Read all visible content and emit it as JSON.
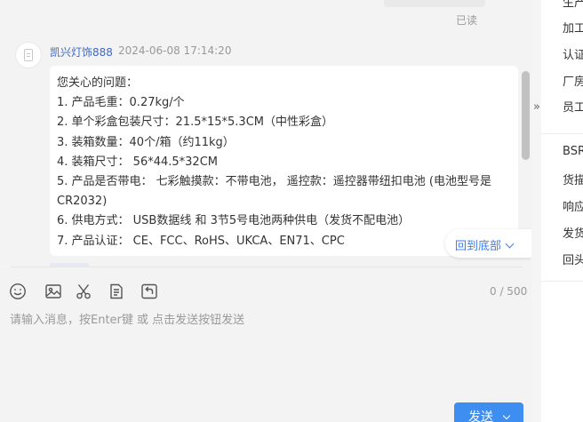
{
  "chat": {
    "read_status": "已读",
    "message": {
      "sender": "凯兴灯饰888",
      "timestamp": "2024-06-08 17:14:20",
      "lines": [
        " 您关心的问题：",
        "1. 产品毛重：0.27kg/个",
        "2. 单个彩盒包装尺寸：21.5*15*5.3CM（中性彩盒）",
        "3. 装箱数量：40个/箱（约11kg）",
        "4. 装箱尺寸： 56*44.5*32CM",
        "5. 产品是否带电： 七彩触摸款：不带电池， 遥控款：遥控器带纽扣电池 (电池型号是CR2032)",
        "6. 供电方式： USB数据线 和 3节5号电池两种供电（发货不配电池）",
        "7. 产品认证： CE、FCC、RoHS、UKCA、EN71、CPC"
      ]
    },
    "back_to_bottom_label": "回到底部"
  },
  "composer": {
    "tools": [
      "emoji-icon",
      "image-icon",
      "scissors-icon",
      "document-icon",
      "recall-icon"
    ],
    "char_count": "0 / 500",
    "placeholder": "请输入消息，按Enter键 或 点击发送按钮发送",
    "send_label": "发送"
  },
  "right_panel": {
    "collapse_glyph": "»",
    "items": [
      "生产",
      "加工",
      "认证",
      "厂房",
      "员工",
      "BSR",
      "货描",
      "响应",
      "发货",
      "回头"
    ]
  },
  "colors": {
    "accent": "#3d8ef0",
    "link": "#3d7ef0",
    "sender_name": "#3d68c9"
  }
}
